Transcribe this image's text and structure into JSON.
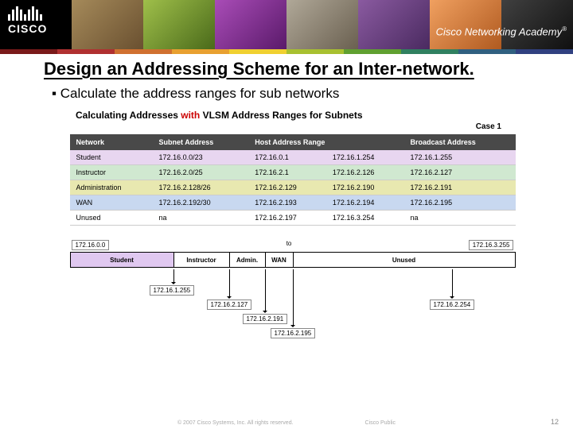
{
  "header": {
    "brand": "CISCO",
    "program": "Cisco Networking Academy",
    "tm": "®"
  },
  "title": "Design an Addressing Scheme for an Inter-network.",
  "bullet": "Calculate the address ranges for sub networks",
  "sub_title_pre": "Calculating Addresses ",
  "sub_title_with": "with",
  "sub_title_post": " VLSM Address Ranges for Subnets",
  "case_label": "Case 1",
  "table": {
    "headers": [
      "Network",
      "Subnet Address",
      "Host Address Range",
      "",
      "Broadcast Address"
    ],
    "rows": [
      [
        "Student",
        "172.16.0.0/23",
        "172.16.0.1",
        "172.16.1.254",
        "172.16.1.255"
      ],
      [
        "Instructor",
        "172.16.2.0/25",
        "172.16.2.1",
        "172.16.2.126",
        "172.16.2.127"
      ],
      [
        "Administration",
        "172.16.2.128/26",
        "172.16.2.129",
        "172.16.2.190",
        "172.16.2.191"
      ],
      [
        "WAN",
        "172.16.2.192/30",
        "172.16.2.193",
        "172.16.2.194",
        "172.16.2.195"
      ],
      [
        "Unused",
        "na",
        "172.16.2.197",
        "172.16.3.254",
        "na"
      ]
    ]
  },
  "range": {
    "start": "172.16.0.0",
    "to": "to",
    "end": "172.16.3.255",
    "segments": [
      "Student",
      "Instructor",
      "Admin.",
      "WAN",
      "Unused"
    ]
  },
  "pointers": {
    "p1": "172.16.1.255",
    "p2": "172.16.2.127",
    "p3": "172.16.2.191",
    "p4": "172.16.2.195",
    "p5": "172.16.2.254"
  },
  "footer": {
    "copyright": "© 2007 Cisco Systems, Inc. All rights reserved.",
    "classification": "Cisco Public",
    "page": "12"
  }
}
